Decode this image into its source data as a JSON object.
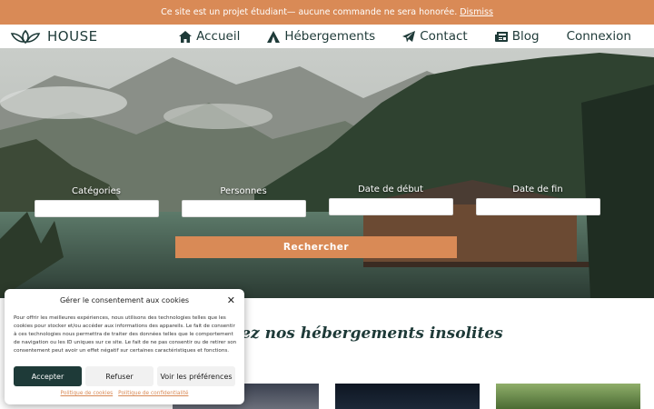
{
  "notice": {
    "text": "Ce site est un projet étudiant— aucune commande ne sera honorée.",
    "dismiss": "Dismiss"
  },
  "header": {
    "logo_text": "HOUSE",
    "nav": [
      {
        "label": "Accueil",
        "icon": "home-icon"
      },
      {
        "label": "Hébergements",
        "icon": "tent-icon"
      },
      {
        "label": "Contact",
        "icon": "paper-plane-icon"
      },
      {
        "label": "Blog",
        "icon": "newspaper-icon"
      },
      {
        "label": "Connexion",
        "icon": ""
      }
    ]
  },
  "search": {
    "fields": [
      {
        "label": "Catégories",
        "value": ""
      },
      {
        "label": "Personnes",
        "value": ""
      },
      {
        "label": "Date de début",
        "value": ""
      },
      {
        "label": "Date de fin",
        "value": ""
      }
    ],
    "button": "Rechercher"
  },
  "section": {
    "title": "rez nos hébergements insolites"
  },
  "cookie": {
    "title": "Gérer le consentement aux cookies",
    "body": "Pour offrir les meilleures expériences, nous utilisons des technologies telles que les cookies pour stocker et/ou accéder aux informations des appareils. Le fait de consentir à ces technologies nous permettra de traiter des données telles que le comportement de navigation ou les ID uniques sur ce site. Le fait de ne pas consentir ou de retirer son consentement peut avoir un effet négatif sur certaines caractéristiques et fonctions.",
    "accept": "Accepter",
    "refuse": "Refuser",
    "prefs": "Voir les préférences",
    "link_cookies": "Politique de cookies",
    "link_privacy": "Politique de confidentialité"
  },
  "colors": {
    "accent": "#d98a56",
    "dark": "#1e3a38"
  }
}
